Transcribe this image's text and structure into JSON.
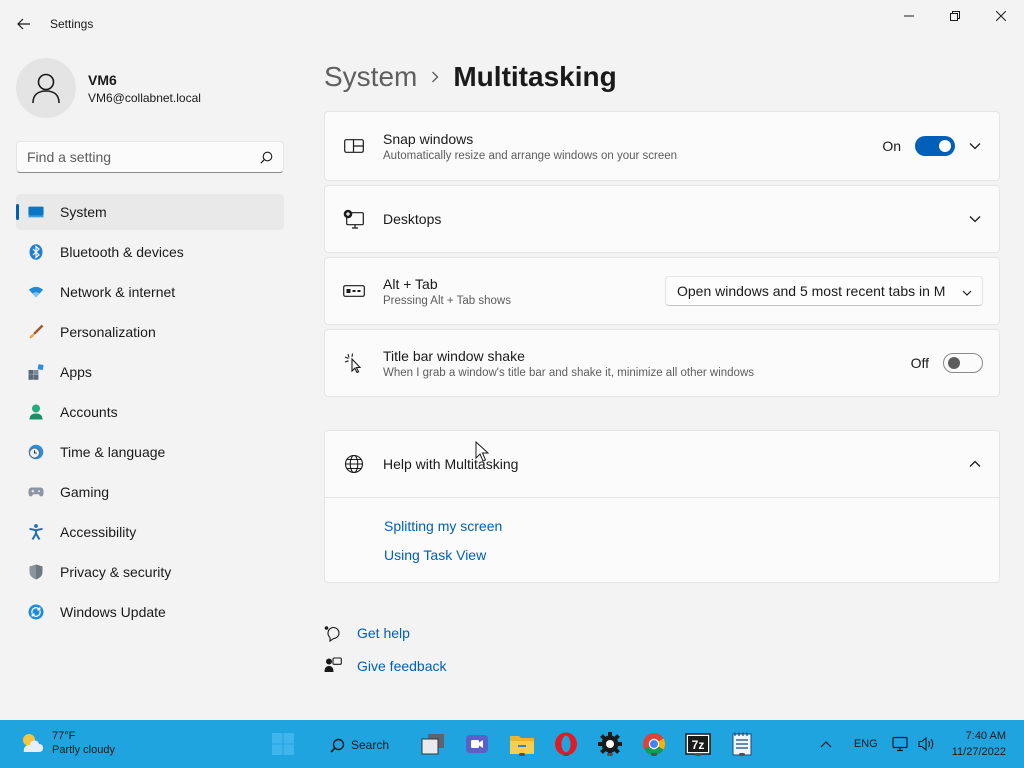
{
  "window": {
    "app_title": "Settings"
  },
  "profile": {
    "name": "VM6",
    "email": "VM6@collabnet.local"
  },
  "search": {
    "placeholder": "Find a setting"
  },
  "sidebar": {
    "items": [
      {
        "label": "System",
        "icon": "system-icon",
        "active": true
      },
      {
        "label": "Bluetooth & devices",
        "icon": "bluetooth-icon"
      },
      {
        "label": "Network & internet",
        "icon": "wifi-icon"
      },
      {
        "label": "Personalization",
        "icon": "brush-icon"
      },
      {
        "label": "Apps",
        "icon": "apps-icon"
      },
      {
        "label": "Accounts",
        "icon": "accounts-icon"
      },
      {
        "label": "Time & language",
        "icon": "clock-icon"
      },
      {
        "label": "Gaming",
        "icon": "gamepad-icon"
      },
      {
        "label": "Accessibility",
        "icon": "accessibility-icon"
      },
      {
        "label": "Privacy & security",
        "icon": "shield-icon"
      },
      {
        "label": "Windows Update",
        "icon": "update-icon"
      }
    ]
  },
  "breadcrumb": {
    "parent": "System",
    "current": "Multitasking"
  },
  "settings": {
    "snap": {
      "title": "Snap windows",
      "desc": "Automatically resize and arrange windows on your screen",
      "state": "On",
      "enabled": true
    },
    "desktops": {
      "title": "Desktops"
    },
    "alt_tab": {
      "title": "Alt + Tab",
      "desc": "Pressing Alt + Tab shows",
      "value": "Open windows and 5 most recent tabs in M"
    },
    "shake": {
      "title": "Title bar window shake",
      "desc": "When I grab a window's title bar and shake it, minimize all other windows",
      "state": "Off",
      "enabled": false
    }
  },
  "help": {
    "title": "Help with Multitasking",
    "links": [
      "Splitting my screen",
      "Using Task View"
    ]
  },
  "footer": {
    "get_help": "Get help",
    "give_feedback": "Give feedback"
  },
  "taskbar": {
    "weather_temp": "77°F",
    "weather_desc": "Partly cloudy",
    "search_label": "Search",
    "lang": "ENG",
    "time": "7:40 AM",
    "date": "11/27/2022",
    "apps": [
      "start-icon",
      "task-view-icon",
      "chat-icon",
      "file-explorer-icon",
      "opera-icon",
      "settings-app-icon",
      "chrome-icon",
      "7zip-icon",
      "notepad-icon"
    ]
  },
  "colors": {
    "accent": "#005fb8",
    "taskbar": "#1fa4e0",
    "background": "#f3f3f3"
  }
}
